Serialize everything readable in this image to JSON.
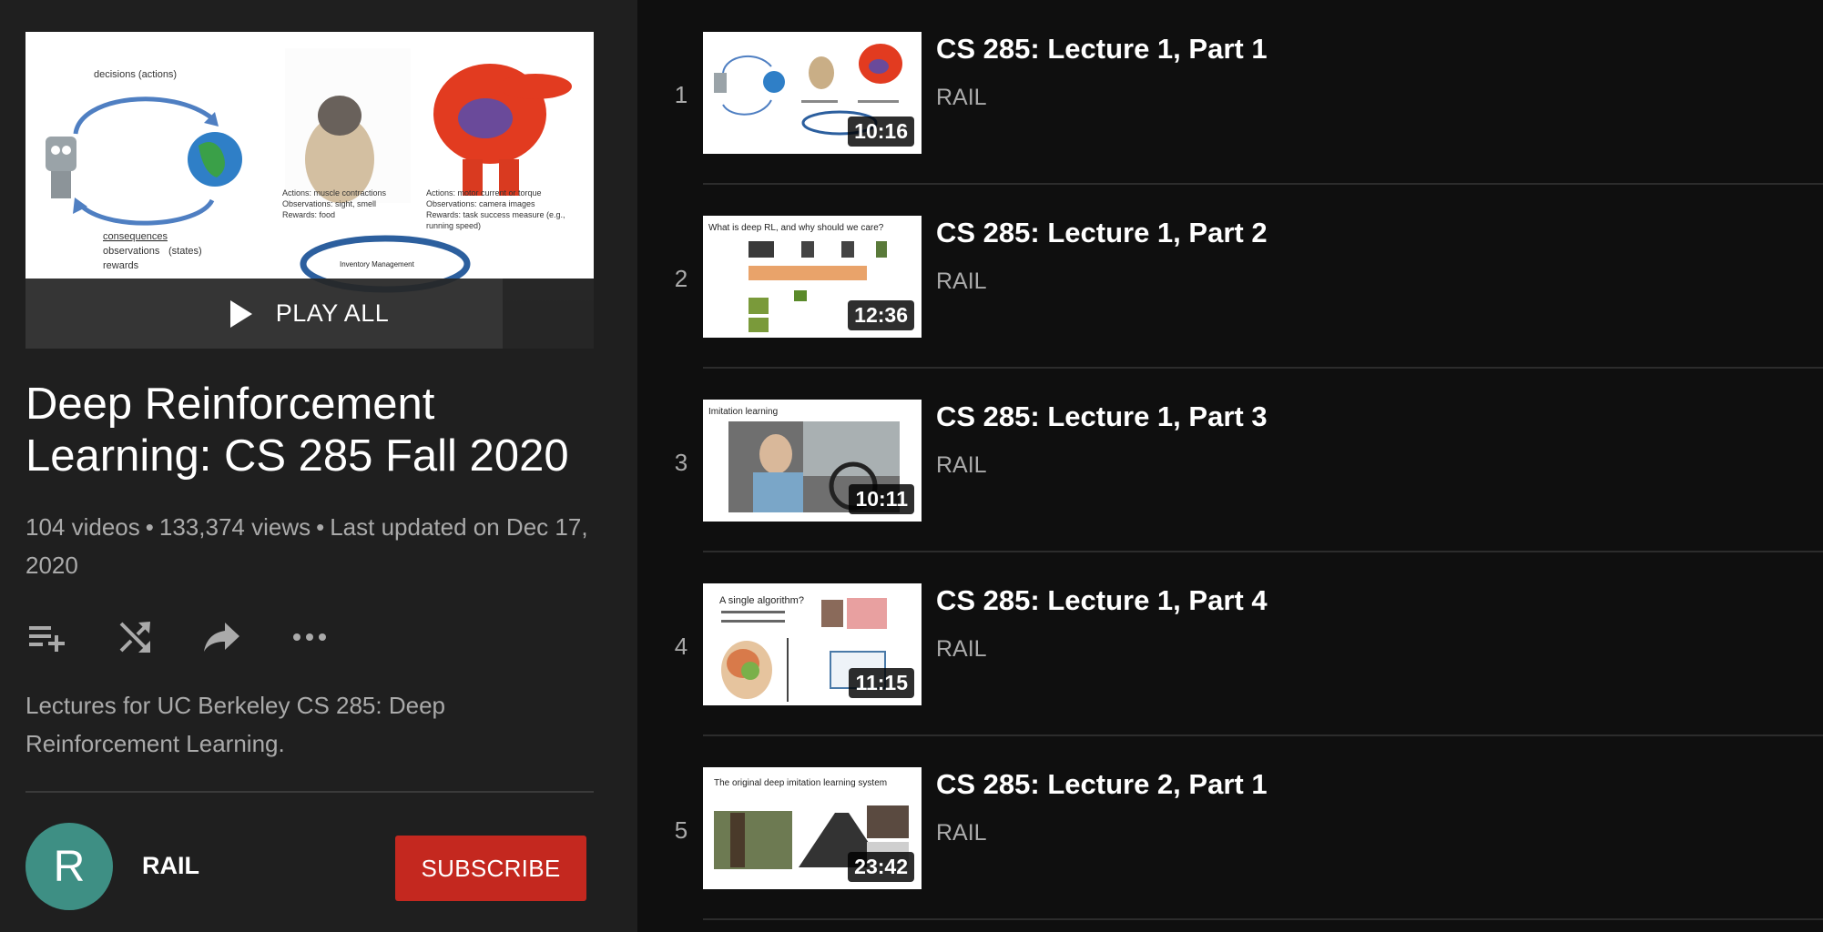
{
  "playlist": {
    "play_all_label": "PLAY ALL",
    "title": "Deep Reinforcement Learning: CS 285 Fall 2020",
    "video_count": "104 videos",
    "views": "133,374 views",
    "updated": "Last updated on Dec 17, 2020",
    "separator": "•",
    "description": "Lectures for UC Berkeley CS 285: Deep Reinforcement Learning.",
    "hero_slide": {
      "loop_top": "decisions (actions)",
      "loop_bottom_1": "consequences",
      "loop_bottom_2": "observations",
      "loop_bottom_3": "(states)",
      "loop_bottom_4": "rewards",
      "dog_1": "Actions: muscle contractions",
      "dog_2": "Observations: sight, smell",
      "dog_3": "Rewards: food",
      "robot_1": "Actions: motor current or torque",
      "robot_2": "Observations: camera images",
      "robot_3": "Rewards: task success measure (e.g.,",
      "robot_4": "running speed)",
      "inventory": "Inventory Management"
    }
  },
  "actions": [
    {
      "icon": "add-to-queue-icon"
    },
    {
      "icon": "shuffle-icon"
    },
    {
      "icon": "share-icon"
    },
    {
      "icon": "more-icon"
    }
  ],
  "owner": {
    "avatar_letter": "R",
    "name": "RAIL",
    "subscribe_label": "SUBSCRIBE",
    "subscribe_color": "#c4281f",
    "avatar_color": "#3e8f84"
  },
  "videos": [
    {
      "index": "1",
      "title": "CS 285: Lecture 1, Part 1",
      "channel": "RAIL",
      "duration": "10:16"
    },
    {
      "index": "2",
      "title": "CS 285: Lecture 1, Part 2",
      "channel": "RAIL",
      "duration": "12:36",
      "slide_title": "What is deep RL, and why should we care?"
    },
    {
      "index": "3",
      "title": "CS 285: Lecture 1, Part 3",
      "channel": "RAIL",
      "duration": "10:11",
      "slide_title": "Imitation learning"
    },
    {
      "index": "4",
      "title": "CS 285: Lecture 1, Part 4",
      "channel": "RAIL",
      "duration": "11:15",
      "slide_title": "A single algorithm?"
    },
    {
      "index": "5",
      "title": "CS 285: Lecture 2, Part 1",
      "channel": "RAIL",
      "duration": "23:42",
      "slide_title": "The original deep imitation learning system"
    }
  ]
}
